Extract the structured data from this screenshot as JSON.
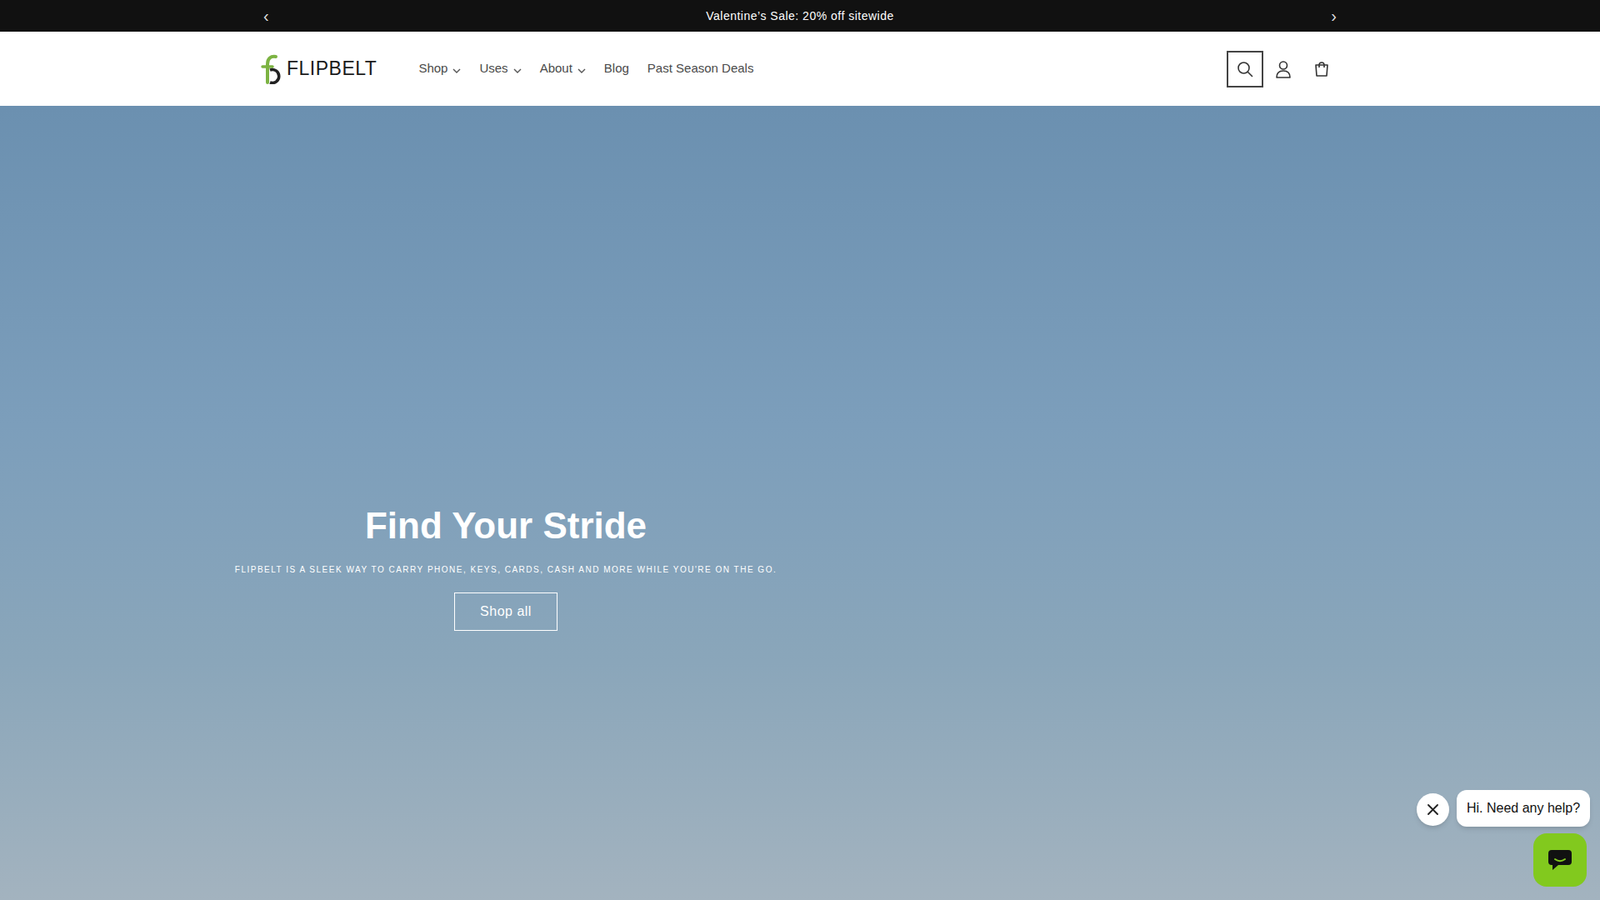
{
  "announcement": {
    "prev": "‹",
    "text": "Valentine’s Sale: 20% off sitewide",
    "next": "›"
  },
  "header": {
    "logo": "FLIPBELT",
    "nav": [
      {
        "label": "Shop",
        "dropdown": true
      },
      {
        "label": "Uses",
        "dropdown": true
      },
      {
        "label": "About",
        "dropdown": true
      },
      {
        "label": "Blog",
        "dropdown": false
      },
      {
        "label": "Past Season Deals",
        "dropdown": false
      }
    ],
    "search": {
      "focused": true
    }
  },
  "hero": {
    "title": "Find Your Stride",
    "subtitle": "FLIPBELT IS A SLEEK WAY TO CARRY PHONE, KEYS, CARDS, CASH AND MORE WHILE YOU'RE ON THE GO.",
    "button": "Shop all"
  },
  "chat": {
    "message": "Hi. Need any help?"
  }
}
